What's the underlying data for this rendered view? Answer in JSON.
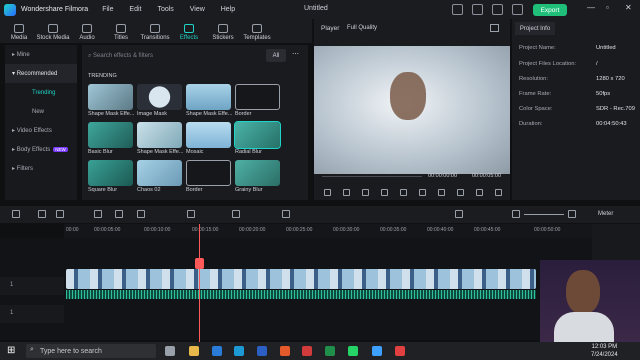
{
  "app": {
    "name": "Wondershare Filmora",
    "menu": [
      "File",
      "Edit",
      "Tools",
      "View",
      "Help"
    ],
    "document_title": "Untitled",
    "export_label": "Export"
  },
  "toolbar": {
    "tools": [
      {
        "label": "Media",
        "icon": "media-icon"
      },
      {
        "label": "Stock Media",
        "icon": "stock-media-icon"
      },
      {
        "label": "Audio",
        "icon": "audio-icon"
      },
      {
        "label": "Titles",
        "icon": "titles-icon"
      },
      {
        "label": "Transitions",
        "icon": "transitions-icon"
      },
      {
        "label": "Effects",
        "icon": "effects-icon"
      },
      {
        "label": "Stickers",
        "icon": "stickers-icon"
      },
      {
        "label": "Templates",
        "icon": "templates-icon"
      }
    ]
  },
  "sidebar": {
    "items": [
      {
        "label": "Mine"
      },
      {
        "label": "Recommended"
      },
      {
        "label": "Trending"
      },
      {
        "label": "New"
      },
      {
        "label": "Video Effects"
      },
      {
        "label": "Body Effects",
        "badge": "NEW"
      },
      {
        "label": "Filters"
      }
    ]
  },
  "library": {
    "search_placeholder": "Search effects & filters",
    "filter_label": "All",
    "section_title": "TRENDING",
    "cards": [
      {
        "label": "Shape Mask Effe..."
      },
      {
        "label": "Image Mask"
      },
      {
        "label": "Shape Mask Effe..."
      },
      {
        "label": "Border"
      },
      {
        "label": "Basic Blur"
      },
      {
        "label": "Shape Mask Effe..."
      },
      {
        "label": "Mosaic"
      },
      {
        "label": "Radial Blur"
      },
      {
        "label": "Square Blur"
      },
      {
        "label": "Chaos 02"
      },
      {
        "label": "Border"
      },
      {
        "label": "Grainy Blur"
      }
    ]
  },
  "player": {
    "tab_label": "Player",
    "quality": "Full Quality",
    "current_time": "00:00:00:00",
    "total_time": "00:00:05:00"
  },
  "project_info": {
    "tab_label": "Project Info",
    "rows": [
      {
        "label": "Project Name:",
        "value": "Untitled"
      },
      {
        "label": "Project Files Location:",
        "value": "/"
      },
      {
        "label": "Resolution:",
        "value": "1280 x 720"
      },
      {
        "label": "Frame Rate:",
        "value": "50fps"
      },
      {
        "label": "Color Space:",
        "value": "SDR - Rec.709"
      },
      {
        "label": "Duration:",
        "value": "00:04:50:43"
      }
    ]
  },
  "timeline": {
    "meter_label": "Meter",
    "ruler_ticks": [
      "00:00",
      "00:00:05:00",
      "00:00:10:00",
      "00:00:15:00",
      "00:00:20:00",
      "00:00:25:00",
      "00:00:30:00",
      "00:00:35:00",
      "00:00:40:00",
      "00:00:45:00",
      "00:00:50:00"
    ],
    "tracks": [
      {
        "label": "1"
      },
      {
        "label": "1"
      }
    ]
  },
  "taskbar": {
    "search_placeholder": "Type here to search",
    "time": "12:03 PM",
    "date": "7/24/2024"
  },
  "colors": {
    "accent": "#1fd3c6",
    "export": "#1fbf7a",
    "playhead": "#ff5a5a"
  }
}
